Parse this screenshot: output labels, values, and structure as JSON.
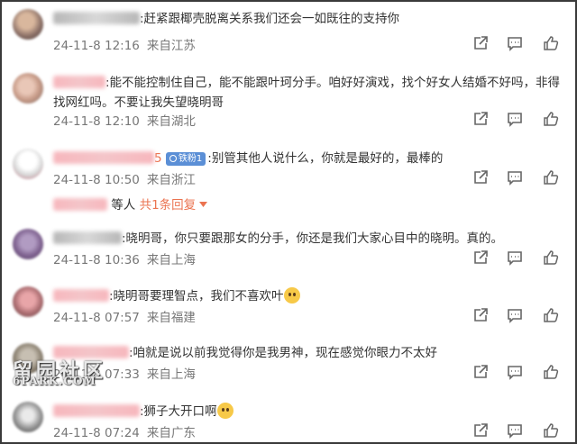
{
  "comments": [
    {
      "text": ":赶紧跟椰壳脱离关系我们还会一如既往的支持你",
      "time": "24-11-8 12:16",
      "location": "来自江苏"
    },
    {
      "text": ":能不能控制住自己，能不能跟叶珂分手。咱好好演戏，找个好女人结婚不好吗，非得找网红吗。不要让我失望晓明哥",
      "time": "24-11-8 12:10",
      "location": "来自湖北"
    },
    {
      "name_suffix": "5",
      "badge": "铁粉1",
      "text": ":别管其他人说什么，你就是最好的，最棒的",
      "time": "24-11-8 10:50",
      "location": "来自浙江"
    },
    {
      "text": ":晓明哥，你只要跟那女的分手，你还是我们大家心目中的晓明。真的。",
      "time": "24-11-8 10:36",
      "location": "来自上海"
    },
    {
      "text": ":晓明哥要理智点，我们不喜欢叶",
      "time": "24-11-8 07:57",
      "location": "来自福建"
    },
    {
      "text": ":咱就是说以前我觉得你是我男神，现在感觉你眼力不太好",
      "time": "24-11-8 07:33",
      "location": "来自上海"
    },
    {
      "text": ":狮子大开口啊",
      "time": "24-11-8 07:24",
      "location": "来自广东"
    }
  ],
  "reply_summary": {
    "suffix": "等人",
    "link": "共1条回复"
  },
  "watermark": {
    "line1": "留园社区",
    "line2": "6PARK.COM"
  },
  "colors": {
    "link": "#eb7350",
    "meta": "#777777",
    "badge": "#5b8fd6"
  }
}
